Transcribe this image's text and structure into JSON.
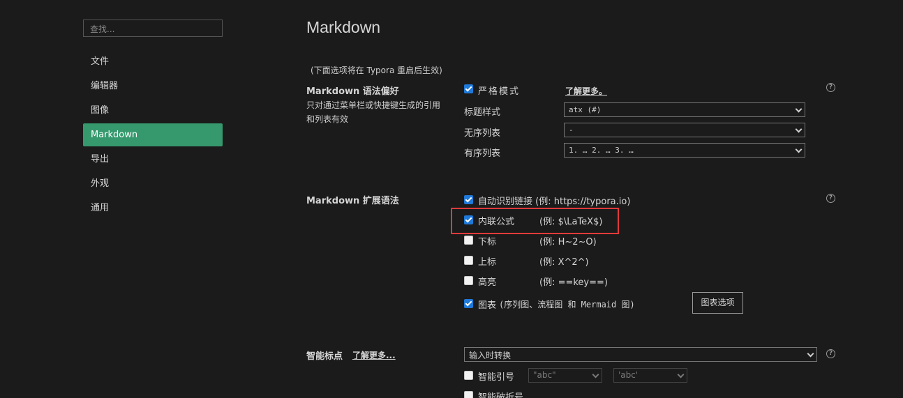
{
  "sidebar": {
    "search_placeholder": "查找...",
    "items": [
      {
        "label": "文件",
        "active": false
      },
      {
        "label": "编辑器",
        "active": false
      },
      {
        "label": "图像",
        "active": false
      },
      {
        "label": "Markdown",
        "active": true
      },
      {
        "label": "导出",
        "active": false
      },
      {
        "label": "外观",
        "active": false
      },
      {
        "label": "通用",
        "active": false
      }
    ]
  },
  "main": {
    "title": "Markdown",
    "note": "(下面选项将在 Typora 重启后生效)",
    "syntax_pref": {
      "title": "Markdown 语法偏好",
      "desc": "只对通过菜单栏或快捷键生成的引用和列表有效",
      "strict_label": "严格模式",
      "strict_checked": true,
      "learn_more": "了解更多。",
      "heading_label": "标题样式",
      "heading_value": "atx (#)",
      "ul_label": "无序列表",
      "ul_value": "-",
      "ol_label": "有序列表",
      "ol_value": "1. … 2. … 3. …"
    },
    "ext_syntax": {
      "title": "Markdown 扩展语法",
      "options": [
        {
          "label": "自动识别链接",
          "example": "(例: https://typora.io)",
          "checked": true
        },
        {
          "label": "内联公式",
          "example": "(例: $\\LaTeX$)",
          "checked": true
        },
        {
          "label": "下标",
          "example": "(例: H~2~O)",
          "checked": false
        },
        {
          "label": "上标",
          "example": "(例: X^2^)",
          "checked": false
        },
        {
          "label": "高亮",
          "example": "(例: ==key==)",
          "checked": false
        },
        {
          "label": "图表",
          "example": "(序列图、流程图 和 Mermaid 图)",
          "checked": true
        }
      ],
      "chart_options_button": "图表选项"
    },
    "smart_punct": {
      "title": "智能标点",
      "learn_more": "了解更多...",
      "mode_value": "输入时转换",
      "smart_quotes_label": "智能引号",
      "smart_quotes_checked": false,
      "double_quote_value": "\"abc\"",
      "single_quote_value": "'abc'",
      "smart_dash_label": "智能破折号",
      "smart_dash_checked": false
    }
  },
  "colors": {
    "accent": "#35996d",
    "checkbox": "#1f79d8",
    "highlight": "#e03a3a",
    "background": "#1b1b1b"
  }
}
